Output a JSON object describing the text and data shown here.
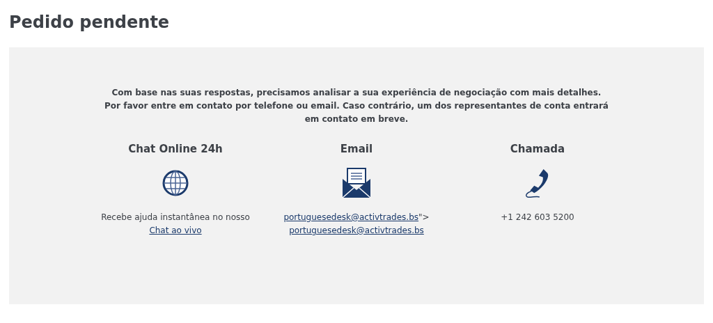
{
  "title": "Pedido pendente",
  "intro": [
    "Com base nas suas respostas, precisamos analisar a sua experiência de negociação com mais detalhes.",
    "Por favor entre em contato por telefone ou email. Caso contrário, um dos representantes de conta entrará em contato em breve."
  ],
  "channels": [
    {
      "kind": "chat",
      "heading": "Chat Online 24h",
      "text": "Recebe ajuda instantânea no nosso",
      "link": "Chat ao vivo"
    },
    {
      "kind": "email",
      "heading": "Email",
      "link": "portuguesedesk@activtrades.bs",
      "text": "\">",
      "link2": "portuguesedesk@activtrades.bs"
    },
    {
      "kind": "phone",
      "heading": "Chamada",
      "text": "+1 242 603 5200"
    }
  ]
}
